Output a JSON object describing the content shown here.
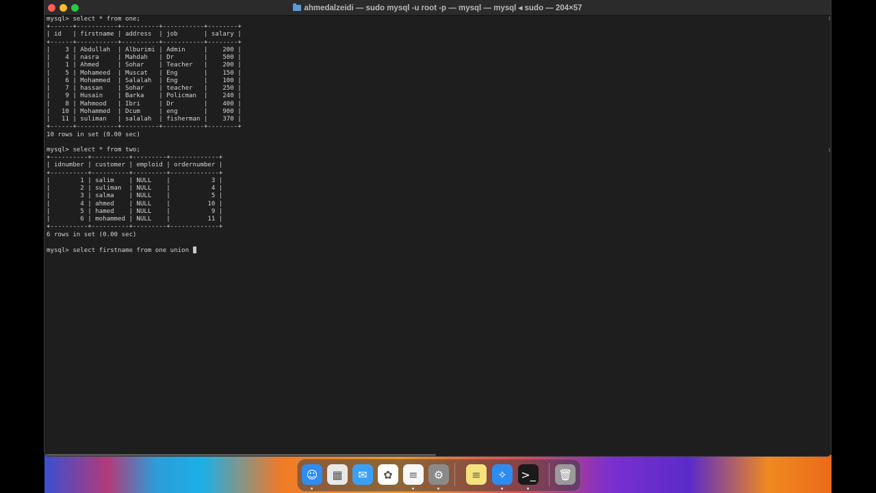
{
  "window": {
    "title": "ahmedalzeidi — sudo mysql -u root -p — mysql — mysql ◂ sudo — 204×57"
  },
  "terminal": {
    "lines": [
      "mysql> select * from one;",
      "+------+-----------+----------+-----------+--------+",
      "| id   | firstname | address  | job       | salary |",
      "+------+-----------+----------+-----------+--------+",
      "|    3 | Abdullah  | Alburimi | Admin     |    200 |",
      "|    4 | nasra     | Mahdah   | Dr        |    500 |",
      "|    1 | Ahmed     | Sohar    | Teacher   |    200 |",
      "|    5 | Mohameed  | Muscat   | Eng       |    150 |",
      "|    6 | Mohammed  | Salalah  | Eng       |    100 |",
      "|    7 | hassan    | Sohar    | teacher   |    250 |",
      "|    9 | Husain    | Barka    | Policman  |    240 |",
      "|    8 | Mahmood   | Ibri     | Dr        |    400 |",
      "|   10 | Mohammed  | Dcum     | eng       |    900 |",
      "|   11 | suliman   | salalah  | fisherman |    370 |",
      "+------+-----------+----------+-----------+--------+",
      "10 rows in set (0.00 sec)",
      "",
      "mysql> select * from two;",
      "+----------+----------+---------+-------------+",
      "| idnumber | customer | emploid | ordernumber |",
      "+----------+----------+---------+-------------+",
      "|        1 | salim    | NULL    |           3 |",
      "|        2 | suliman  | NULL    |           4 |",
      "|        3 | salma    | NULL    |           5 |",
      "|        4 | ahmed    | NULL    |          10 |",
      "|        5 | hamed    | NULL    |           9 |",
      "|        6 | mohammed | NULL    |          11 |",
      "+----------+----------+---------+-------------+",
      "6 rows in set (0.00 sec)",
      ""
    ],
    "prompt_line": "mysql> select firstname from one union "
  },
  "dock": {
    "apps": [
      {
        "name": "finder-icon",
        "glyph": "☺",
        "color": "#2f8cf0"
      },
      {
        "name": "launchpad-icon",
        "glyph": "▦",
        "color": "#e8e8e8"
      },
      {
        "name": "mail-icon",
        "glyph": "✉",
        "color": "#3aa0f5"
      },
      {
        "name": "photos-icon",
        "glyph": "✿",
        "color": "#ffffff"
      },
      {
        "name": "notes-icon",
        "glyph": "≡",
        "color": "#f7f7f7"
      },
      {
        "name": "system-settings-icon",
        "glyph": "⚙",
        "color": "#8a8a8a"
      },
      {
        "name": "stickies-icon",
        "glyph": "≡",
        "color": "#f5e27a"
      },
      {
        "name": "safari-icon",
        "glyph": "✧",
        "color": "#2d8cf0"
      },
      {
        "name": "terminal-icon",
        "glyph": ">_",
        "color": "#1a1a1a"
      },
      {
        "name": "trash-icon",
        "glyph": "🗑",
        "color": "#9a9a9a"
      }
    ]
  }
}
